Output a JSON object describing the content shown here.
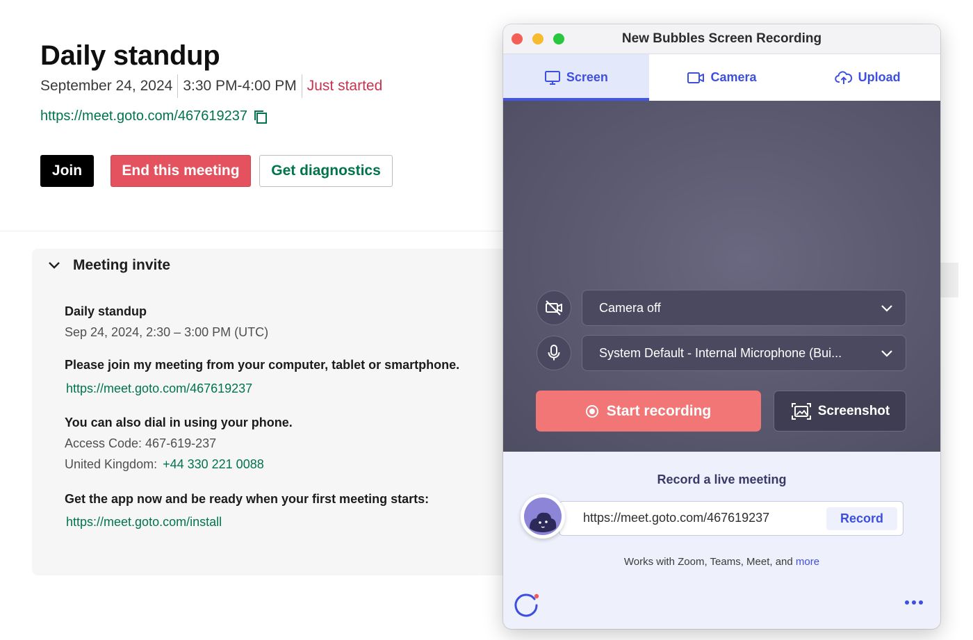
{
  "meeting": {
    "title": "Daily standup",
    "date": "September 24, 2024",
    "time": "3:30 PM-4:00 PM",
    "status": "Just started",
    "link": "https://meet.goto.com/467619237",
    "buttons": {
      "join": "Join",
      "end": "End this meeting",
      "diagnostics": "Get diagnostics"
    }
  },
  "invite": {
    "header": "Meeting invite",
    "name": "Daily standup",
    "when": "Sep 24, 2024, 2:30 – 3:00 PM (UTC)",
    "join_prompt": "Please join my meeting from your computer, tablet or smartphone.",
    "join_link": "https://meet.goto.com/467619237",
    "dial_prompt": "You can also dial in using your phone.",
    "access_code": "Access Code: 467-619-237",
    "country": "United Kingdom:",
    "phone": "+44 330 221 0088",
    "app_prompt": "Get the app now and be ready when your first meeting starts:",
    "app_link": "https://meet.goto.com/install"
  },
  "recorder": {
    "window_title": "New Bubbles Screen Recording",
    "tabs": [
      {
        "label": "Screen",
        "icon": "monitor-icon",
        "active": true
      },
      {
        "label": "Camera",
        "icon": "video-camera-icon",
        "active": false
      },
      {
        "label": "Upload",
        "icon": "cloud-upload-icon",
        "active": false
      }
    ],
    "camera_select": "Camera off",
    "mic_select": "System Default - Internal Microphone (Bui...",
    "start_recording": "Start recording",
    "screenshot": "Screenshot",
    "live_title": "Record a live meeting",
    "live_url": "https://meet.goto.com/467619237",
    "record_label": "Record",
    "works_with": "Works with Zoom, Teams, Meet, and",
    "more_label": "more"
  },
  "colors": {
    "accent": "#3d4fe0",
    "record": "#f27676",
    "end_meeting": "#e4525f",
    "link_green": "#00744a",
    "status_red": "#c8324f"
  }
}
